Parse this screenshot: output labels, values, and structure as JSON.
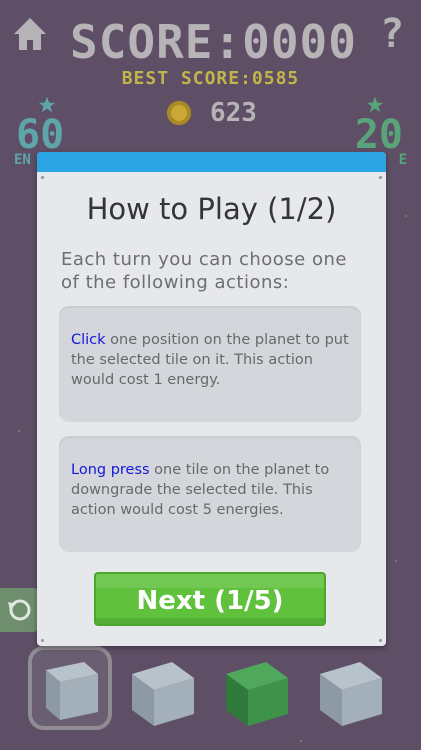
{
  "hud": {
    "score": "SCORE:0000",
    "best_score": "BEST SCORE:0585",
    "coins": "623",
    "energy_value": "60",
    "energy_label_visible": "EN",
    "right_value": "20",
    "right_label_visible": "E"
  },
  "icons": {
    "home": "home-icon",
    "help": "help-icon",
    "help_glyph": "?",
    "coin": "coin-icon",
    "star": "star-icon",
    "undo": "undo-icon"
  },
  "dialog": {
    "title": "How to Play (1/2)",
    "intro": "Each turn you can choose one of the following actions:",
    "actions": [
      {
        "keyword": "Click",
        "text": " one position on the planet to put the selected tile on it. This action would cost 1 energy."
      },
      {
        "keyword": "Long press",
        "text": " one tile on the planet to downgrade the selected tile. This action would cost 5 energies."
      }
    ],
    "next_label": "Next (1/5)"
  },
  "colors": {
    "background": "#5e4f66",
    "dialog_band": "#2ca3e2",
    "keyword": "#1417d9",
    "next_button": "#5fc13c",
    "energy": "#5ea5a9",
    "right_counter": "#5aa47c",
    "best_score": "#c1b54a"
  },
  "tiles": [
    {
      "type": "grey-cube",
      "selected": true
    },
    {
      "type": "grey-cube",
      "selected": false
    },
    {
      "type": "green-cube",
      "selected": false
    },
    {
      "type": "grey-cube",
      "selected": false
    }
  ]
}
